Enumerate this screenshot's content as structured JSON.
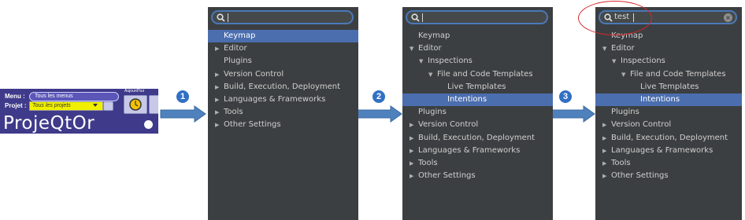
{
  "projeqtor": {
    "menu_label": "Menu :",
    "menu_value": "Tous les menus",
    "projet_label": "Projet :",
    "projet_value": "Tous les projets",
    "logo_text": "ProjeQtOr",
    "today_label": "Aujourd'hui"
  },
  "steps": [
    {
      "label": "1"
    },
    {
      "label": "2"
    },
    {
      "label": "3"
    }
  ],
  "panels": [
    {
      "search_value": "",
      "items": [
        {
          "label": "Keymap",
          "arrow": "",
          "level": 0,
          "selected": true
        },
        {
          "label": "Editor",
          "arrow": "collapsed",
          "level": 0
        },
        {
          "label": "Plugins",
          "arrow": "",
          "level": 0
        },
        {
          "label": "Version Control",
          "arrow": "collapsed",
          "level": 0
        },
        {
          "label": "Build, Execution, Deployment",
          "arrow": "collapsed",
          "level": 0
        },
        {
          "label": "Languages & Frameworks",
          "arrow": "collapsed",
          "level": 0
        },
        {
          "label": "Tools",
          "arrow": "collapsed",
          "level": 0
        },
        {
          "label": "Other Settings",
          "arrow": "collapsed",
          "level": 0
        }
      ]
    },
    {
      "search_value": "",
      "items": [
        {
          "label": "Keymap",
          "arrow": "",
          "level": 0
        },
        {
          "label": "Editor",
          "arrow": "expanded",
          "level": 0
        },
        {
          "label": "Inspections",
          "arrow": "expanded",
          "level": 1
        },
        {
          "label": "File and Code Templates",
          "arrow": "expanded",
          "level": 2
        },
        {
          "label": "Live Templates",
          "arrow": "",
          "level": 3
        },
        {
          "label": "Intentions",
          "arrow": "",
          "level": 3,
          "selected": true
        },
        {
          "label": "Plugins",
          "arrow": "",
          "level": 0
        },
        {
          "label": "Version Control",
          "arrow": "collapsed",
          "level": 0
        },
        {
          "label": "Build, Execution, Deployment",
          "arrow": "collapsed",
          "level": 0
        },
        {
          "label": "Languages & Frameworks",
          "arrow": "collapsed",
          "level": 0
        },
        {
          "label": "Tools",
          "arrow": "collapsed",
          "level": 0
        },
        {
          "label": "Other Settings",
          "arrow": "collapsed",
          "level": 0
        }
      ]
    },
    {
      "search_value": "test",
      "items": [
        {
          "label": "Keymap",
          "arrow": "",
          "level": 0
        },
        {
          "label": "Editor",
          "arrow": "expanded",
          "level": 0
        },
        {
          "label": "Inspections",
          "arrow": "expanded",
          "level": 1
        },
        {
          "label": "File and Code Templates",
          "arrow": "expanded",
          "level": 2
        },
        {
          "label": "Live Templates",
          "arrow": "",
          "level": 3
        },
        {
          "label": "Intentions",
          "arrow": "",
          "level": 3,
          "selected": true
        },
        {
          "label": "Plugins",
          "arrow": "",
          "level": 0
        },
        {
          "label": "Version Control",
          "arrow": "collapsed",
          "level": 0
        },
        {
          "label": "Build, Execution, Deployment",
          "arrow": "collapsed",
          "level": 0
        },
        {
          "label": "Languages & Frameworks",
          "arrow": "collapsed",
          "level": 0
        },
        {
          "label": "Tools",
          "arrow": "collapsed",
          "level": 0
        },
        {
          "label": "Other Settings",
          "arrow": "collapsed",
          "level": 0
        }
      ]
    }
  ],
  "colors": {
    "panel_bg": "#3c3f41",
    "selection": "#4b6eaf",
    "search_border": "#4a79b7",
    "arrow_fill": "#4f81bd",
    "badge": "#3170c4",
    "highlight_ring": "#d8262a"
  }
}
